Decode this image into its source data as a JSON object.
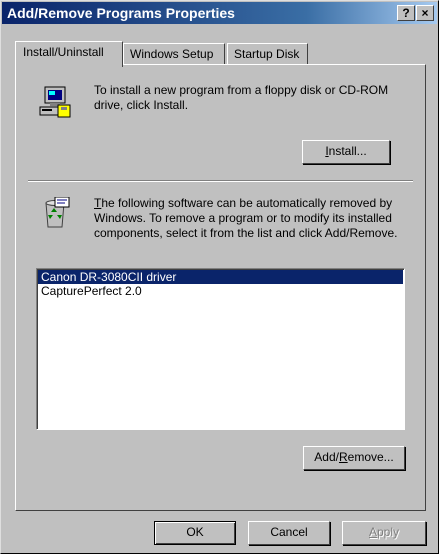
{
  "window": {
    "title": "Add/Remove Programs Properties",
    "help_label": "?",
    "close_label": "×"
  },
  "tabs": [
    {
      "label": "Install/Uninstall",
      "active": true
    },
    {
      "label": "Windows Setup",
      "active": false
    },
    {
      "label": "Startup Disk",
      "active": false
    }
  ],
  "install_section": {
    "description": "To install a new program from a floppy disk or CD-ROM drive, click Install.",
    "button_prefix": "",
    "button_underline": "I",
    "button_rest": "nstall..."
  },
  "uninstall_section": {
    "description_underline": "T",
    "description_rest": "he following software can be automatically removed by Windows. To remove a program or to modify its installed components, select it from the list and click Add/Remove.",
    "programs": [
      {
        "name": "Canon DR-3080CII driver",
        "selected": true
      },
      {
        "name": "CapturePerfect 2.0",
        "selected": false
      }
    ],
    "button_prefix": "Add/",
    "button_underline": "R",
    "button_rest": "emove..."
  },
  "footer": {
    "ok_label": "OK",
    "cancel_label": "Cancel",
    "apply_prefix": "",
    "apply_underline": "A",
    "apply_rest": "pply"
  }
}
